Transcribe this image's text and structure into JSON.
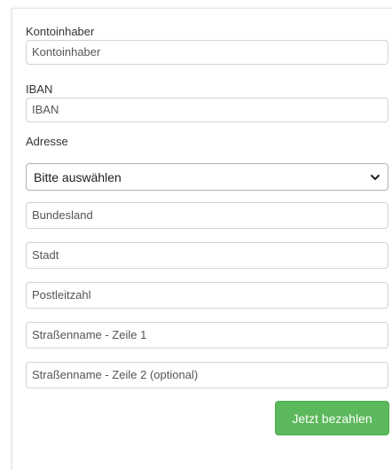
{
  "form": {
    "account_holder_label": "Kontoinhaber",
    "account_holder_placeholder": "Kontoinhaber",
    "iban_label": "IBAN",
    "iban_placeholder": "IBAN",
    "address_label": "Adresse",
    "address_select_value": "Bitte auswählen",
    "state_placeholder": "Bundesland",
    "city_placeholder": "Stadt",
    "postal_code_placeholder": "Postleitzahl",
    "street_line1_placeholder": "Straßenname - Zeile 1",
    "street_line2_placeholder": "Straßenname - Zeile 2 (optional)",
    "submit_label": "Jetzt bezahlen"
  },
  "colors": {
    "submit_button": "#5cb85c",
    "input_border": "#cfd4da",
    "label_text": "#333333"
  },
  "icons": {
    "select_arrow": "chevron-down-icon"
  }
}
